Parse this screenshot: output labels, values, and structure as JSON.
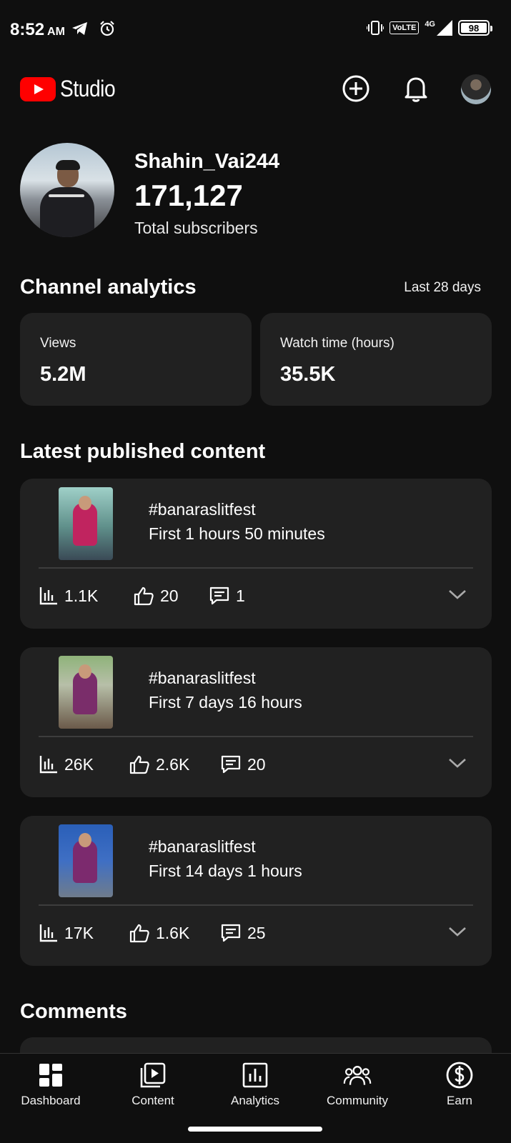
{
  "status_bar": {
    "time": "8:52",
    "ampm": "AM",
    "network": "VoLTE",
    "signal": "4G",
    "battery": "98"
  },
  "header": {
    "app_name": "Studio",
    "icons": [
      "create-icon",
      "notification-bell-icon",
      "account-avatar"
    ]
  },
  "profile": {
    "channel_name": "Shahin_Vai244",
    "subscriber_count": "171,127",
    "subscriber_label": "Total subscribers"
  },
  "analytics": {
    "title": "Channel analytics",
    "period": "Last 28 days",
    "stats": [
      {
        "label": "Views",
        "value": "5.2M"
      },
      {
        "label": "Watch time (hours)",
        "value": "35.5K"
      }
    ]
  },
  "latest_content": {
    "title": "Latest published content",
    "items": [
      {
        "title": "#banaraslitfest",
        "subtitle": "First 1 hours 50 minutes",
        "views": "1.1K",
        "likes": "20",
        "comments": "1"
      },
      {
        "title": "#banaraslitfest",
        "subtitle": "First 7 days 16 hours",
        "views": "26K",
        "likes": "2.6K",
        "comments": "20"
      },
      {
        "title": "#banaraslitfest",
        "subtitle": "First 14 days 1 hours",
        "views": "17K",
        "likes": "1.6K",
        "comments": "25"
      }
    ]
  },
  "comments": {
    "title": "Comments"
  },
  "bottom_nav": {
    "items": [
      {
        "label": "Dashboard",
        "icon": "dashboard-icon"
      },
      {
        "label": "Content",
        "icon": "content-icon"
      },
      {
        "label": "Analytics",
        "icon": "analytics-icon"
      },
      {
        "label": "Community",
        "icon": "community-icon"
      },
      {
        "label": "Earn",
        "icon": "earn-icon"
      }
    ]
  },
  "colors": {
    "background": "#0f0f0f",
    "card": "#212121",
    "brand_red": "#ff0000",
    "text": "#ffffff"
  }
}
